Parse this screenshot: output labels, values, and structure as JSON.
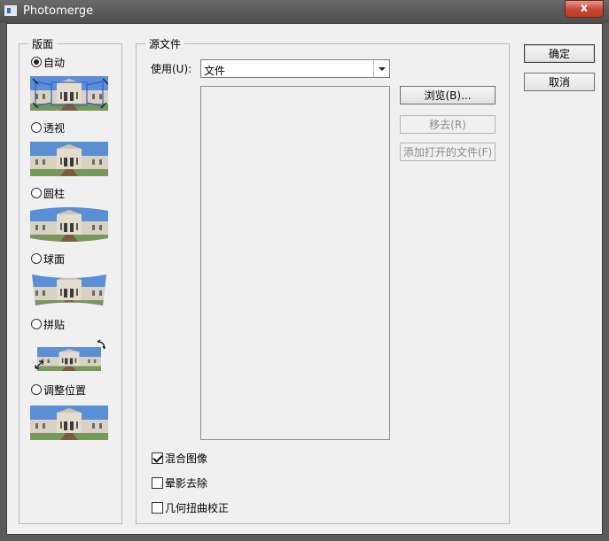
{
  "window": {
    "title": "Photomerge",
    "close_glyph": "x"
  },
  "layout_group": {
    "legend": "版面",
    "options": [
      {
        "label": "自动",
        "selected": true
      },
      {
        "label": "透视",
        "selected": false
      },
      {
        "label": "圆柱",
        "selected": false
      },
      {
        "label": "球面",
        "selected": false
      },
      {
        "label": "拼贴",
        "selected": false
      },
      {
        "label": "调整位置",
        "selected": false
      }
    ]
  },
  "source_group": {
    "legend": "源文件",
    "use_label": "使用(U):",
    "use_value": "文件",
    "browse_button": "浏览(B)...",
    "remove_button": "移去(R)",
    "add_open_button": "添加打开的文件(F)",
    "checkboxes": [
      {
        "label": "混合图像",
        "checked": true
      },
      {
        "label": "晕影去除",
        "checked": false
      },
      {
        "label": "几何扭曲校正",
        "checked": false
      }
    ]
  },
  "actions": {
    "ok": "确定",
    "cancel": "取消"
  },
  "colors": {
    "sky": "#5a8fd6",
    "building": "#d9d2c3",
    "ground": "#7a5c44",
    "grass": "#76985a",
    "selection_outline": "#2f5bd3"
  }
}
